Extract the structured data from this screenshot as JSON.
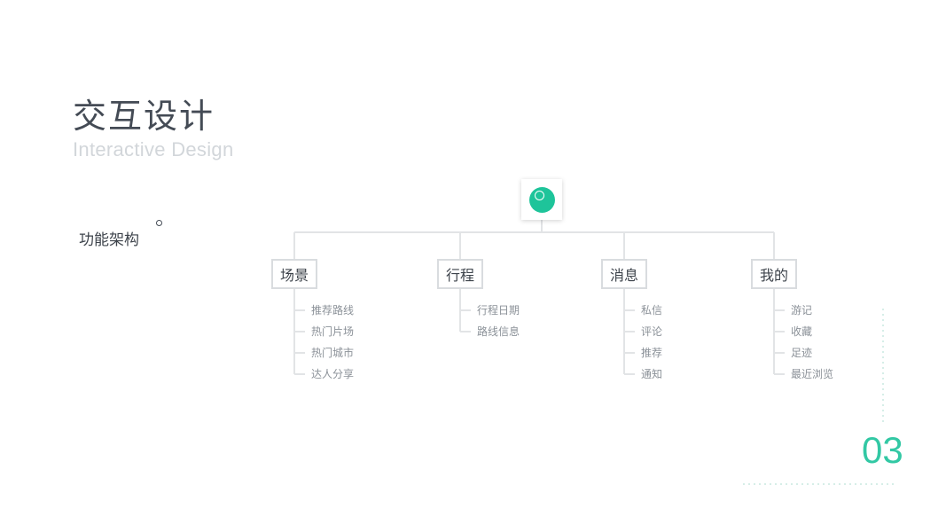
{
  "header": {
    "title": "交互设计",
    "subtitle": "Interactive Design"
  },
  "section": {
    "label": "功能架构"
  },
  "tree": {
    "root_icon": "app-logo-icon",
    "accent_color": "#1ec49a",
    "categories": [
      {
        "label": "场景",
        "children": [
          "推荐路线",
          "热门片场",
          "热门城市",
          "达人分享"
        ]
      },
      {
        "label": "行程",
        "children": [
          "行程日期",
          "路线信息"
        ]
      },
      {
        "label": "消息",
        "children": [
          "私信",
          "评论",
          "推荐",
          "通知"
        ]
      },
      {
        "label": "我的",
        "children": [
          "游记",
          "收藏",
          "足迹",
          "最近浏览"
        ]
      }
    ]
  },
  "footer": {
    "page_number": "03",
    "page_number_color": "#32c8a4"
  }
}
